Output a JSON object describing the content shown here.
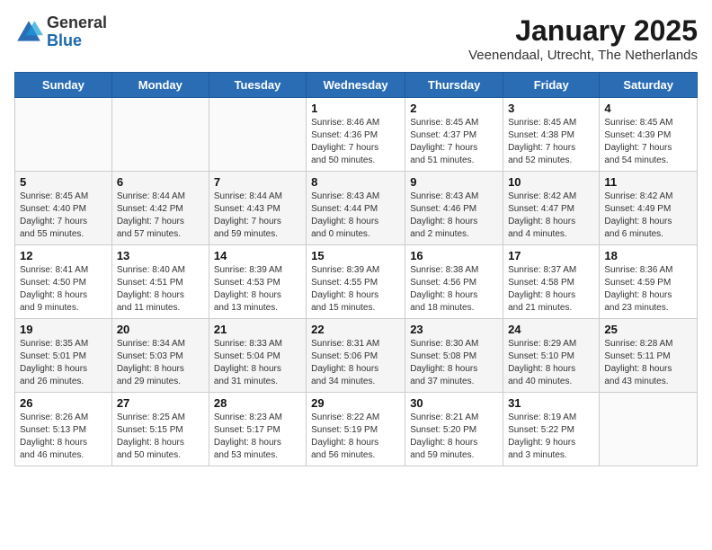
{
  "header": {
    "logo_general": "General",
    "logo_blue": "Blue",
    "title": "January 2025",
    "subtitle": "Veenendaal, Utrecht, The Netherlands"
  },
  "days_of_week": [
    "Sunday",
    "Monday",
    "Tuesday",
    "Wednesday",
    "Thursday",
    "Friday",
    "Saturday"
  ],
  "weeks": [
    [
      {
        "day": "",
        "info": ""
      },
      {
        "day": "",
        "info": ""
      },
      {
        "day": "",
        "info": ""
      },
      {
        "day": "1",
        "info": "Sunrise: 8:46 AM\nSunset: 4:36 PM\nDaylight: 7 hours\nand 50 minutes."
      },
      {
        "day": "2",
        "info": "Sunrise: 8:45 AM\nSunset: 4:37 PM\nDaylight: 7 hours\nand 51 minutes."
      },
      {
        "day": "3",
        "info": "Sunrise: 8:45 AM\nSunset: 4:38 PM\nDaylight: 7 hours\nand 52 minutes."
      },
      {
        "day": "4",
        "info": "Sunrise: 8:45 AM\nSunset: 4:39 PM\nDaylight: 7 hours\nand 54 minutes."
      }
    ],
    [
      {
        "day": "5",
        "info": "Sunrise: 8:45 AM\nSunset: 4:40 PM\nDaylight: 7 hours\nand 55 minutes."
      },
      {
        "day": "6",
        "info": "Sunrise: 8:44 AM\nSunset: 4:42 PM\nDaylight: 7 hours\nand 57 minutes."
      },
      {
        "day": "7",
        "info": "Sunrise: 8:44 AM\nSunset: 4:43 PM\nDaylight: 7 hours\nand 59 minutes."
      },
      {
        "day": "8",
        "info": "Sunrise: 8:43 AM\nSunset: 4:44 PM\nDaylight: 8 hours\nand 0 minutes."
      },
      {
        "day": "9",
        "info": "Sunrise: 8:43 AM\nSunset: 4:46 PM\nDaylight: 8 hours\nand 2 minutes."
      },
      {
        "day": "10",
        "info": "Sunrise: 8:42 AM\nSunset: 4:47 PM\nDaylight: 8 hours\nand 4 minutes."
      },
      {
        "day": "11",
        "info": "Sunrise: 8:42 AM\nSunset: 4:49 PM\nDaylight: 8 hours\nand 6 minutes."
      }
    ],
    [
      {
        "day": "12",
        "info": "Sunrise: 8:41 AM\nSunset: 4:50 PM\nDaylight: 8 hours\nand 9 minutes."
      },
      {
        "day": "13",
        "info": "Sunrise: 8:40 AM\nSunset: 4:51 PM\nDaylight: 8 hours\nand 11 minutes."
      },
      {
        "day": "14",
        "info": "Sunrise: 8:39 AM\nSunset: 4:53 PM\nDaylight: 8 hours\nand 13 minutes."
      },
      {
        "day": "15",
        "info": "Sunrise: 8:39 AM\nSunset: 4:55 PM\nDaylight: 8 hours\nand 15 minutes."
      },
      {
        "day": "16",
        "info": "Sunrise: 8:38 AM\nSunset: 4:56 PM\nDaylight: 8 hours\nand 18 minutes."
      },
      {
        "day": "17",
        "info": "Sunrise: 8:37 AM\nSunset: 4:58 PM\nDaylight: 8 hours\nand 21 minutes."
      },
      {
        "day": "18",
        "info": "Sunrise: 8:36 AM\nSunset: 4:59 PM\nDaylight: 8 hours\nand 23 minutes."
      }
    ],
    [
      {
        "day": "19",
        "info": "Sunrise: 8:35 AM\nSunset: 5:01 PM\nDaylight: 8 hours\nand 26 minutes."
      },
      {
        "day": "20",
        "info": "Sunrise: 8:34 AM\nSunset: 5:03 PM\nDaylight: 8 hours\nand 29 minutes."
      },
      {
        "day": "21",
        "info": "Sunrise: 8:33 AM\nSunset: 5:04 PM\nDaylight: 8 hours\nand 31 minutes."
      },
      {
        "day": "22",
        "info": "Sunrise: 8:31 AM\nSunset: 5:06 PM\nDaylight: 8 hours\nand 34 minutes."
      },
      {
        "day": "23",
        "info": "Sunrise: 8:30 AM\nSunset: 5:08 PM\nDaylight: 8 hours\nand 37 minutes."
      },
      {
        "day": "24",
        "info": "Sunrise: 8:29 AM\nSunset: 5:10 PM\nDaylight: 8 hours\nand 40 minutes."
      },
      {
        "day": "25",
        "info": "Sunrise: 8:28 AM\nSunset: 5:11 PM\nDaylight: 8 hours\nand 43 minutes."
      }
    ],
    [
      {
        "day": "26",
        "info": "Sunrise: 8:26 AM\nSunset: 5:13 PM\nDaylight: 8 hours\nand 46 minutes."
      },
      {
        "day": "27",
        "info": "Sunrise: 8:25 AM\nSunset: 5:15 PM\nDaylight: 8 hours\nand 50 minutes."
      },
      {
        "day": "28",
        "info": "Sunrise: 8:23 AM\nSunset: 5:17 PM\nDaylight: 8 hours\nand 53 minutes."
      },
      {
        "day": "29",
        "info": "Sunrise: 8:22 AM\nSunset: 5:19 PM\nDaylight: 8 hours\nand 56 minutes."
      },
      {
        "day": "30",
        "info": "Sunrise: 8:21 AM\nSunset: 5:20 PM\nDaylight: 8 hours\nand 59 minutes."
      },
      {
        "day": "31",
        "info": "Sunrise: 8:19 AM\nSunset: 5:22 PM\nDaylight: 9 hours\nand 3 minutes."
      },
      {
        "day": "",
        "info": ""
      }
    ]
  ]
}
